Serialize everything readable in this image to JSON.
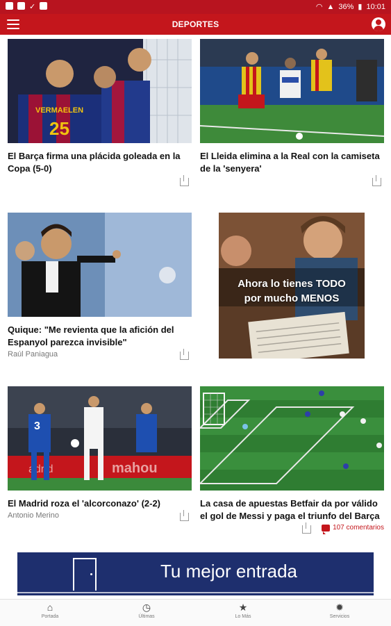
{
  "status_bar": {
    "battery": "36%",
    "time": "10:01"
  },
  "app_bar": {
    "title": "DEPORTES"
  },
  "articles": [
    {
      "headline": "El Barça firma una plácida goleada en la Copa (5-0)",
      "author": ""
    },
    {
      "headline": "El Lleida elimina a la Real con la camiseta de la 'senyera'",
      "author": ""
    },
    {
      "headline": "Quique: \"Me revienta que la afición del Espanyol parezca invisible\"",
      "author": "Raúl Paniagua"
    },
    {
      "headline": "El Madrid roza el 'alcorconazo' (2-2)",
      "author": "Antonio Merino"
    },
    {
      "headline": "La casa de apuestas Betfair da por válido el gol de Messi y paga el triunfo del Barça",
      "author": "",
      "comments": "107 comentarios"
    }
  ],
  "ads": {
    "side": {
      "line1": "Ahora lo tienes TODO",
      "line2": "por mucho MENOS"
    },
    "banner": {
      "slogan": "Tu mejor entrada"
    }
  },
  "bottom_nav": [
    {
      "label": "Portada",
      "icon": "home-icon"
    },
    {
      "label": "Últimas",
      "icon": "clock-icon"
    },
    {
      "label": "Lo Más",
      "icon": "star-icon"
    },
    {
      "label": "Servicios",
      "icon": "sun-icon"
    }
  ],
  "colors": {
    "brand_red": "#c4161c",
    "ad_banner_blue": "#1e2f6e"
  }
}
